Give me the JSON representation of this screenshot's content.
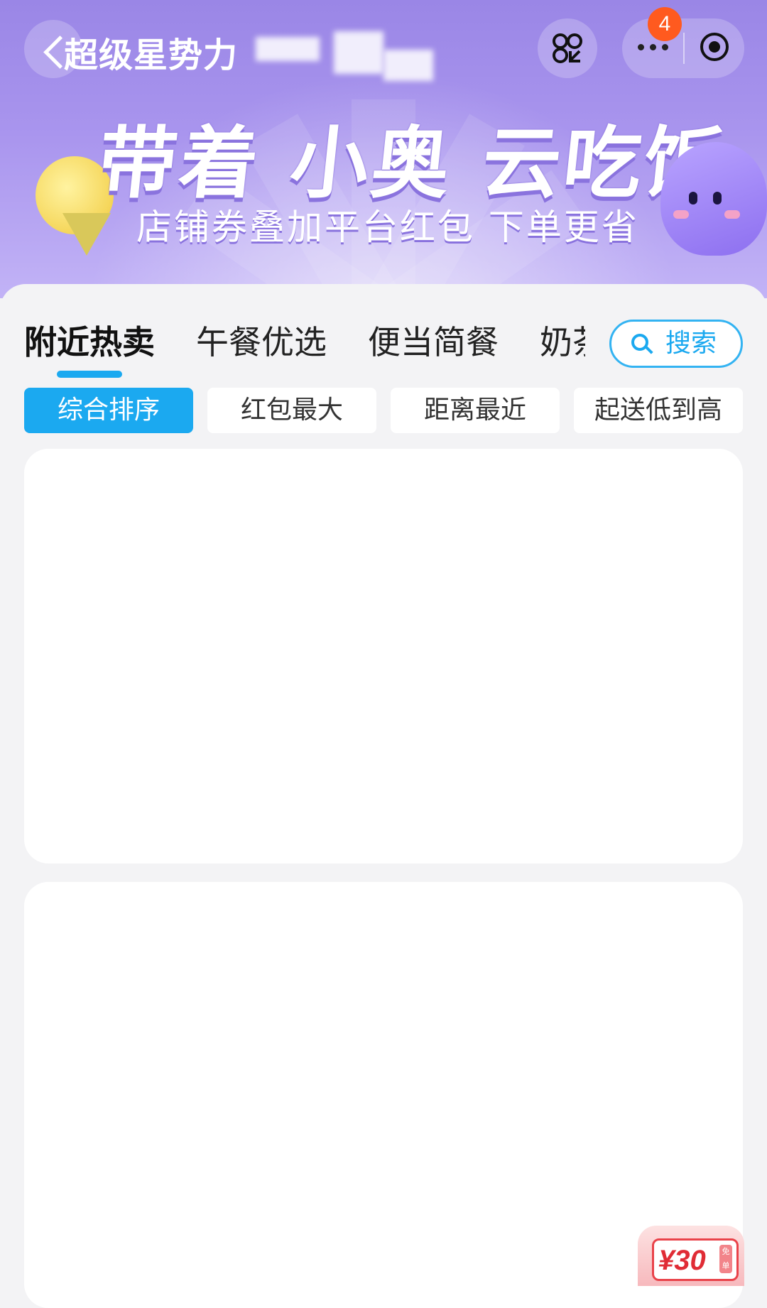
{
  "header": {
    "mini_app_title": "超级星势力",
    "notification_count": "4",
    "colors": {
      "banner_start": "#9a86e6",
      "banner_end": "#c2b3f6",
      "badge": "#ff5a1f"
    }
  },
  "banner": {
    "headline": "带着 小奥 云吃饭",
    "subline": "店铺券叠加平台红包 下单更省"
  },
  "category_tabs": [
    {
      "label": "附近热卖",
      "active": true
    },
    {
      "label": "午餐优选",
      "active": false
    },
    {
      "label": "便当简餐",
      "active": false
    },
    {
      "label": "奶茶",
      "active": false
    }
  ],
  "search": {
    "label": "搜索"
  },
  "sort_options": [
    {
      "label": "综合排序",
      "active": true
    },
    {
      "label": "红包最大",
      "active": false
    },
    {
      "label": "距离最近",
      "active": false
    },
    {
      "label": "起送低到高",
      "active": false
    }
  ],
  "coupon": {
    "amount": "¥30",
    "tag": "免单"
  },
  "accent_color": "#1ba9f0"
}
